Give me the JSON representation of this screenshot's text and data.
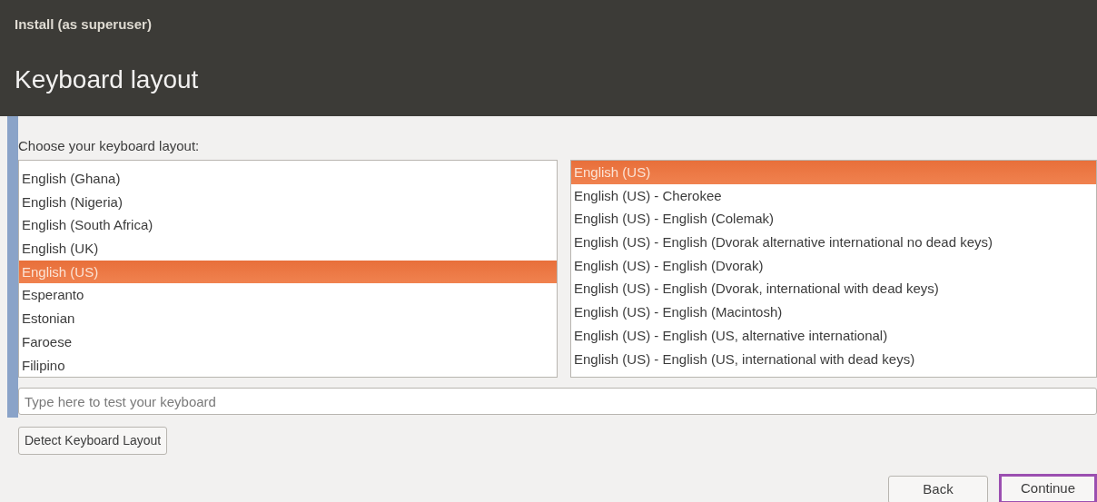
{
  "window": {
    "title": "Install (as superuser)"
  },
  "heading": "Keyboard layout",
  "prompt": "Choose your keyboard layout:",
  "layouts": [
    {
      "label": "English (Ghana)",
      "selected": false
    },
    {
      "label": "English (Nigeria)",
      "selected": false
    },
    {
      "label": "English (South Africa)",
      "selected": false
    },
    {
      "label": "English (UK)",
      "selected": false
    },
    {
      "label": "English (US)",
      "selected": true
    },
    {
      "label": "Esperanto",
      "selected": false
    },
    {
      "label": "Estonian",
      "selected": false
    },
    {
      "label": "Faroese",
      "selected": false
    },
    {
      "label": "Filipino",
      "selected": false
    }
  ],
  "variants": [
    {
      "label": "English (US)",
      "selected": true
    },
    {
      "label": "English (US) - Cherokee",
      "selected": false
    },
    {
      "label": "English (US) - English (Colemak)",
      "selected": false
    },
    {
      "label": "English (US) - English (Dvorak alternative international no dead keys)",
      "selected": false
    },
    {
      "label": "English (US) - English (Dvorak)",
      "selected": false
    },
    {
      "label": "English (US) - English (Dvorak, international with dead keys)",
      "selected": false
    },
    {
      "label": "English (US) - English (Macintosh)",
      "selected": false
    },
    {
      "label": "English (US) - English (US, alternative international)",
      "selected": false
    },
    {
      "label": "English (US) - English (US, international with dead keys)",
      "selected": false
    }
  ],
  "test_field": {
    "placeholder": "Type here to test your keyboard"
  },
  "detect_button": "Detect Keyboard Layout",
  "buttons": [
    {
      "label": "Back",
      "highlighted": false
    },
    {
      "label": "Continue",
      "highlighted": true
    }
  ]
}
